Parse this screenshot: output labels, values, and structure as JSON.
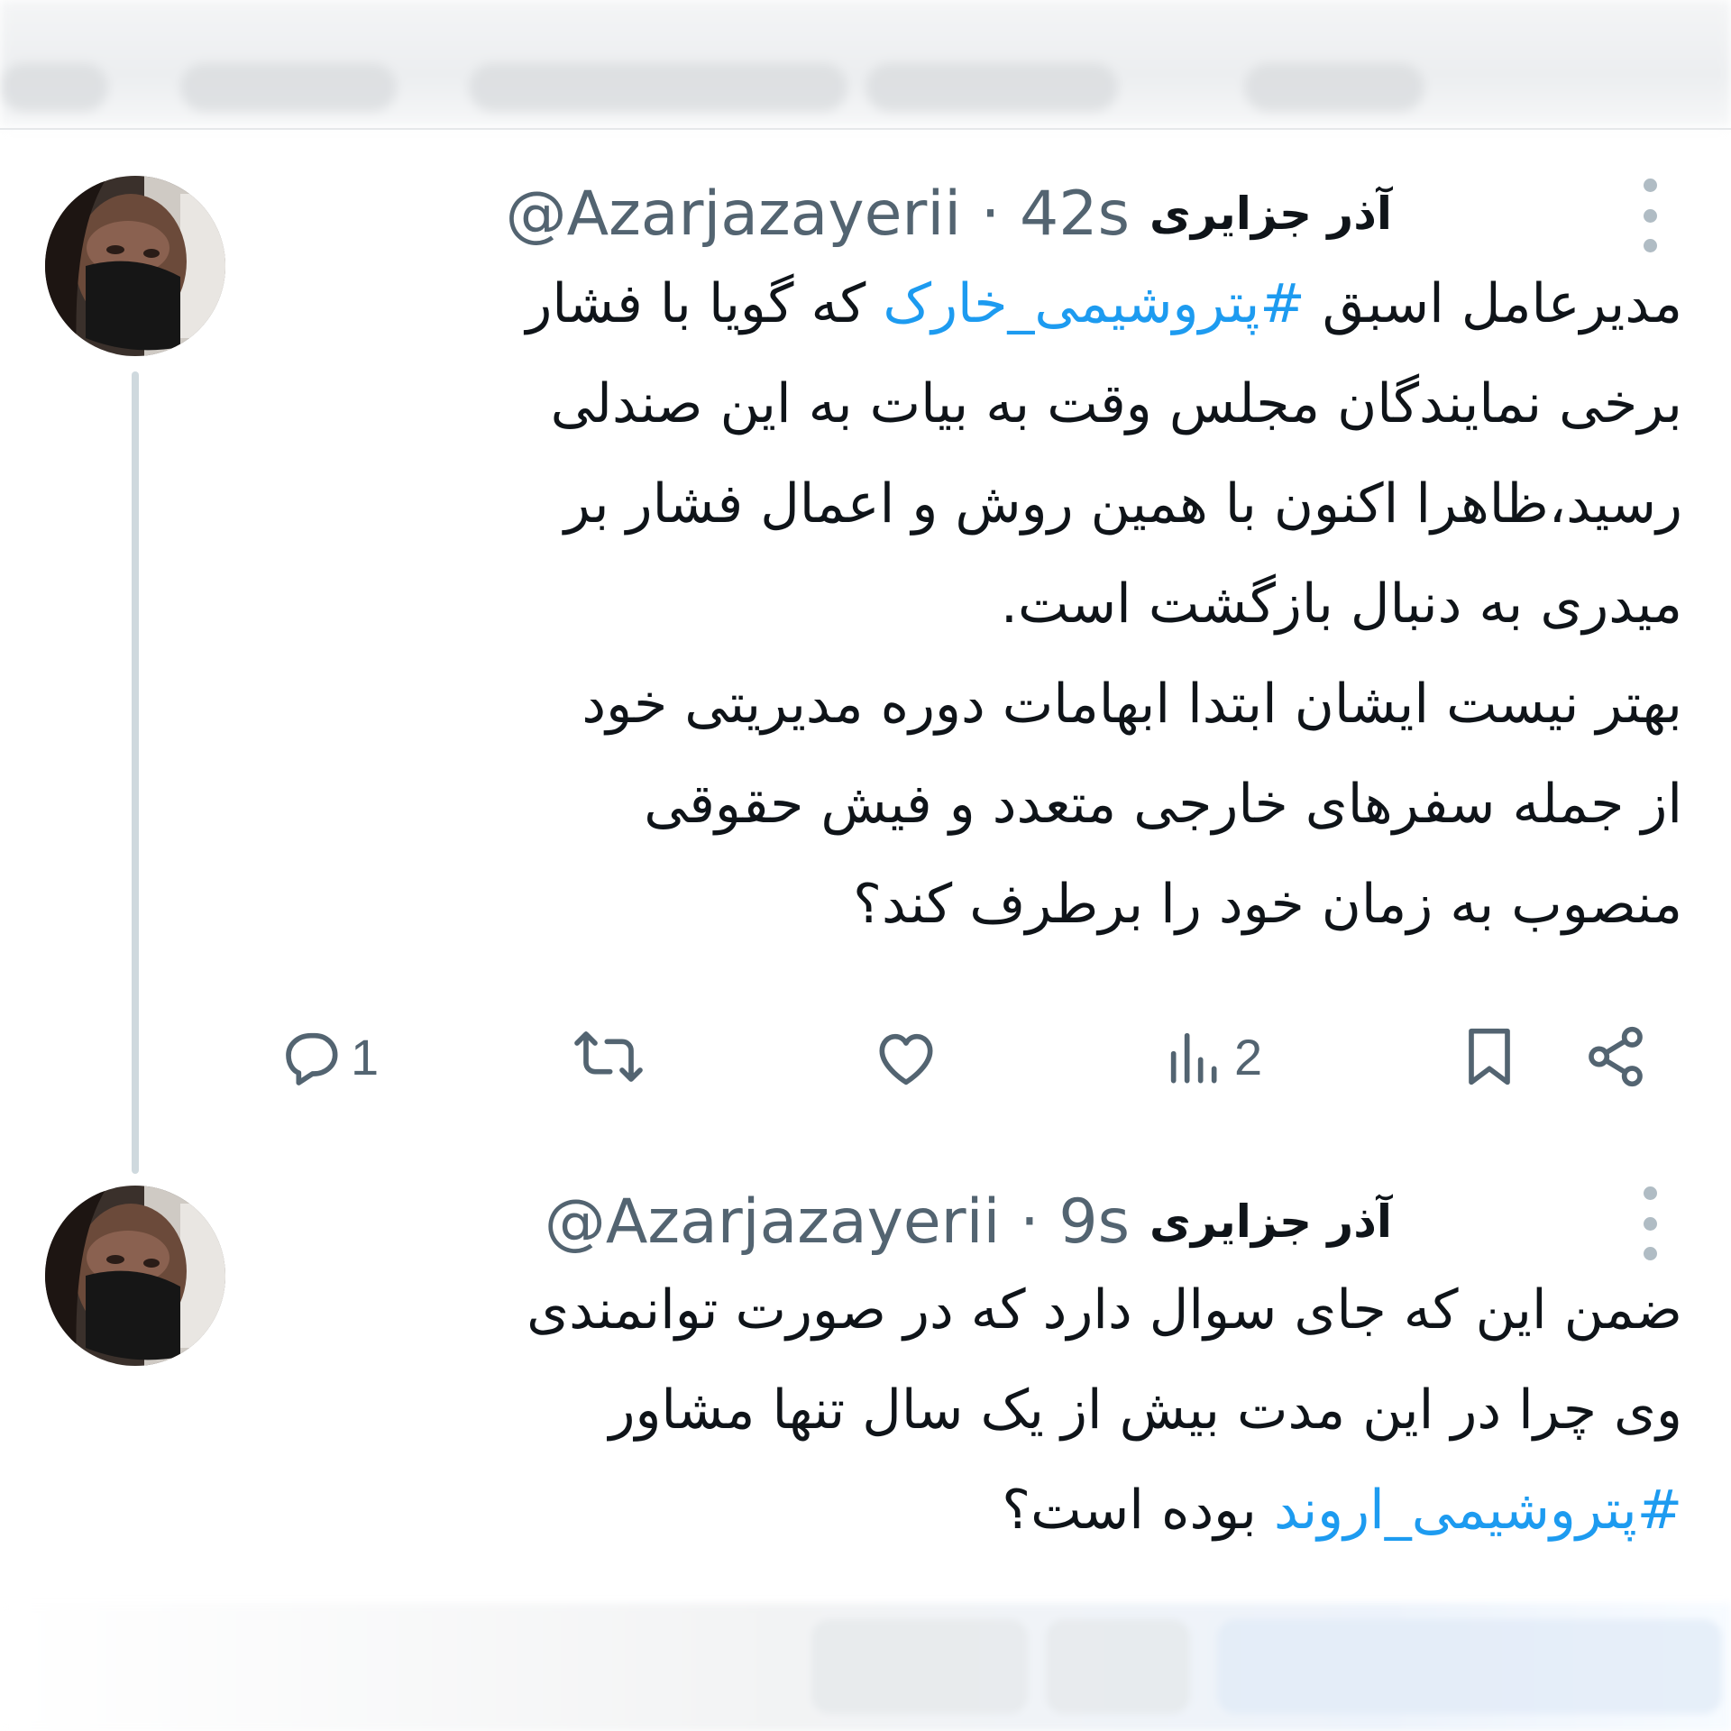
{
  "colors": {
    "text": "#0f1419",
    "muted": "#536471",
    "hashtag": "#1d9bf0",
    "thread_line": "#cfd9de"
  },
  "tweets": [
    {
      "name": "آذر جزایری",
      "handle": "@Azarjazayerii",
      "separator": "·",
      "time": "42s",
      "lines": [
        {
          "pre": "مدیرعامل اسبق ",
          "hashtag": "#پتروشیمی_خارک",
          "post": " که گویا با فشار"
        },
        {
          "pre": "برخی نمایندگان مجلس وقت به بیات به این صندلی",
          "hashtag": "",
          "post": ""
        },
        {
          "pre": "رسید،ظاهرا اکنون با همین روش و اعمال فشار بر",
          "hashtag": "",
          "post": ""
        },
        {
          "pre": "میدری به دنبال بازگشت است.",
          "hashtag": "",
          "post": ""
        },
        {
          "pre": "بهتر نیست ایشان ابتدا ابهامات دوره مدیریتی خود",
          "hashtag": "",
          "post": ""
        },
        {
          "pre": "از جمله سفرهای خارجی متعدد و فیش حقوقی",
          "hashtag": "",
          "post": ""
        },
        {
          "pre": "منصوب به زمان خود را برطرف کند؟",
          "hashtag": "",
          "post": ""
        }
      ],
      "actions": {
        "reply_icon": "reply-icon",
        "reply_count": "1",
        "retweet_icon": "retweet-icon",
        "like_icon": "heart-icon",
        "views_icon": "views-icon",
        "views_count": "2",
        "bookmark_icon": "bookmark-icon",
        "share_icon": "share-icon"
      }
    },
    {
      "name": "آذر جزایری",
      "handle": "@Azarjazayerii",
      "separator": "·",
      "time": "9s",
      "lines": [
        {
          "pre": "ضمن این که جای سوال دارد که در صورت توانمندی",
          "hashtag": "",
          "post": ""
        },
        {
          "pre": "وی چرا در این مدت بیش از یک سال تنها مشاور",
          "hashtag": "",
          "post": ""
        },
        {
          "pre": "",
          "hashtag": "#پتروشیمی_اروند",
          "post": " بوده است؟"
        }
      ]
    }
  ]
}
